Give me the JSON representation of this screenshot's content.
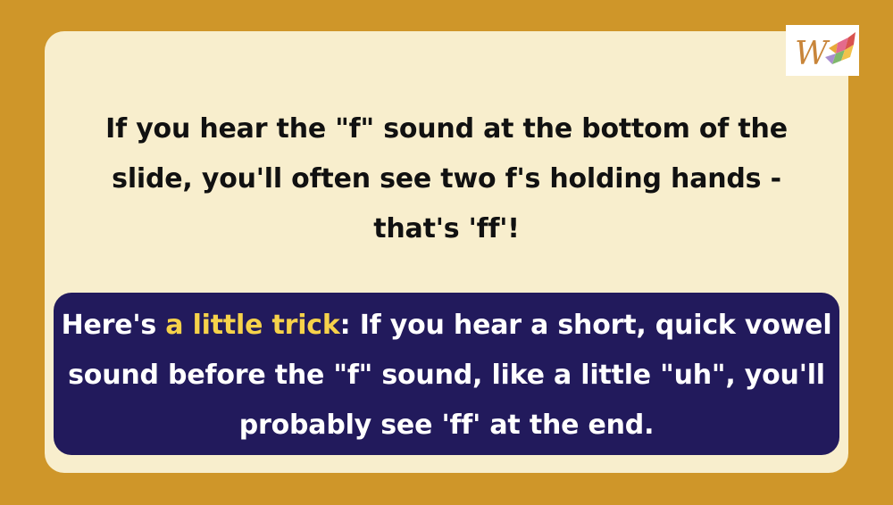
{
  "main_text": "If you hear the \"f\" sound at the bottom of the slide, you'll often see two f's holding hands - that's 'ff'!",
  "tip": {
    "lead": "Here's ",
    "highlight": "a little trick",
    "rest": ": If you hear a short, quick vowel sound before the \"f\" sound, like a little \"uh\", you'll probably see 'ff' at the end."
  },
  "logo": {
    "letter": "W",
    "icon": "brand-logo"
  },
  "colors": {
    "background": "#cf9629",
    "card": "#f8eecd",
    "tip_box": "#221a5c",
    "highlight": "#f6d24a"
  }
}
